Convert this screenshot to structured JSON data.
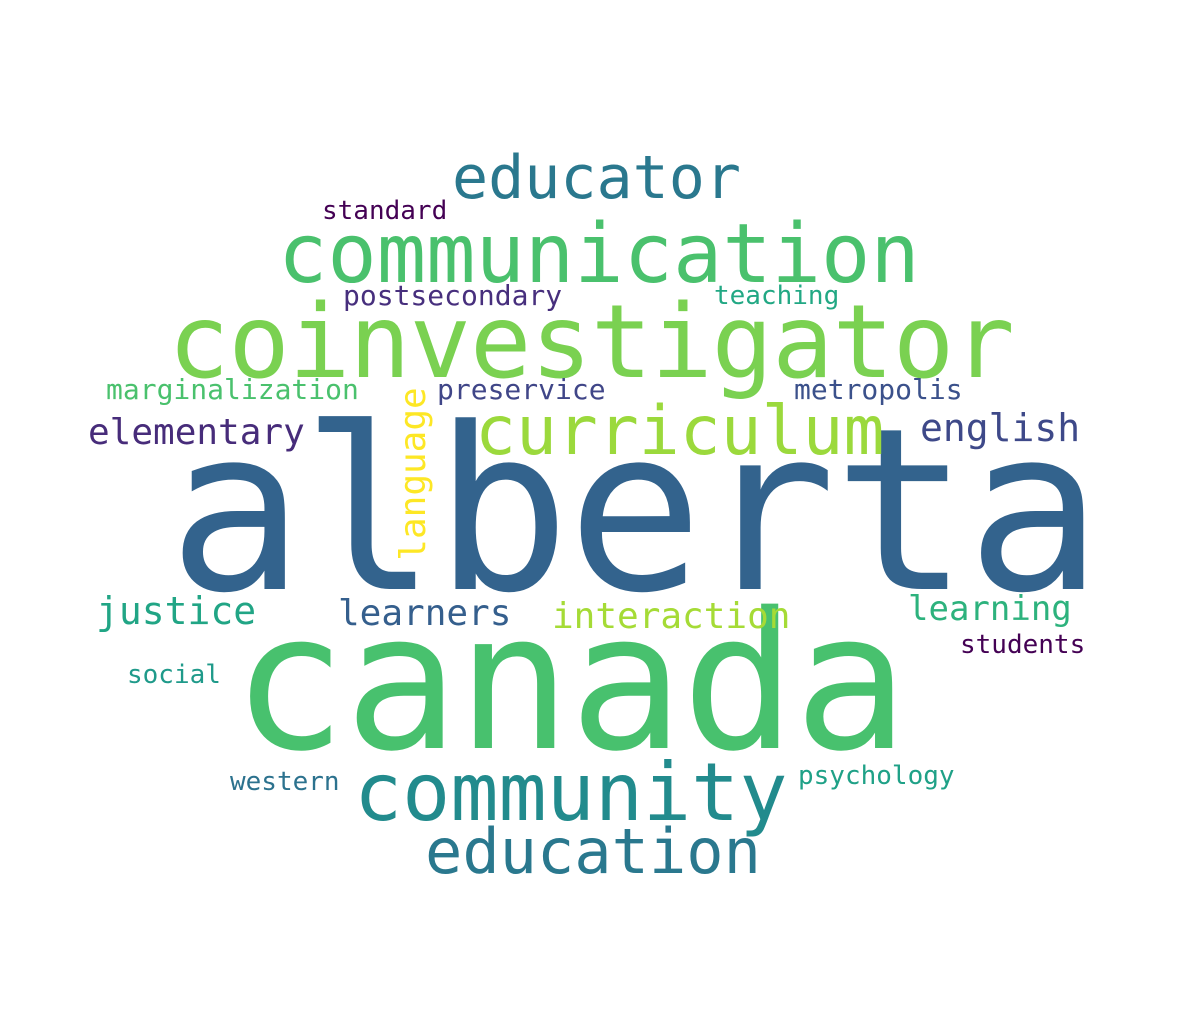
{
  "words": {
    "alberta": {
      "text": "alberta",
      "color": "#33638d"
    },
    "canada": {
      "text": "canada",
      "color": "#48c16e"
    },
    "coinvestigator": {
      "text": "coinvestigator",
      "color": "#7ad151"
    },
    "communication": {
      "text": "communication",
      "color": "#4ac16d"
    },
    "curriculum": {
      "text": "curriculum",
      "color": "#9bd93c"
    },
    "community": {
      "text": "community",
      "color": "#228b8d"
    },
    "education": {
      "text": "education",
      "color": "#2a788e"
    },
    "educator": {
      "text": "educator",
      "color": "#2a788e"
    },
    "elementary": {
      "text": "elementary",
      "color": "#472c7a"
    },
    "english": {
      "text": "english",
      "color": "#3e4989"
    },
    "justice": {
      "text": "justice",
      "color": "#21a585"
    },
    "learners": {
      "text": "learners",
      "color": "#355f8d"
    },
    "interaction": {
      "text": "interaction",
      "color": "#a5db36"
    },
    "learning": {
      "text": "learning",
      "color": "#2db27d"
    },
    "language": {
      "text": "language",
      "color": "#fde725"
    },
    "marginalization": {
      "text": "marginalization",
      "color": "#4ac16d"
    },
    "preservice": {
      "text": "preservice",
      "color": "#404688"
    },
    "metropolis": {
      "text": "metropolis",
      "color": "#3b518b"
    },
    "postsecondary": {
      "text": "postsecondary",
      "color": "#472f7d"
    },
    "teaching": {
      "text": "teaching",
      "color": "#22a884"
    },
    "standard": {
      "text": "standard",
      "color": "#440154"
    },
    "students": {
      "text": "students",
      "color": "#440154"
    },
    "social": {
      "text": "social",
      "color": "#1f9a8a"
    },
    "western": {
      "text": "western",
      "color": "#2c728e"
    },
    "psychology": {
      "text": "psychology",
      "color": "#1fa187"
    }
  }
}
